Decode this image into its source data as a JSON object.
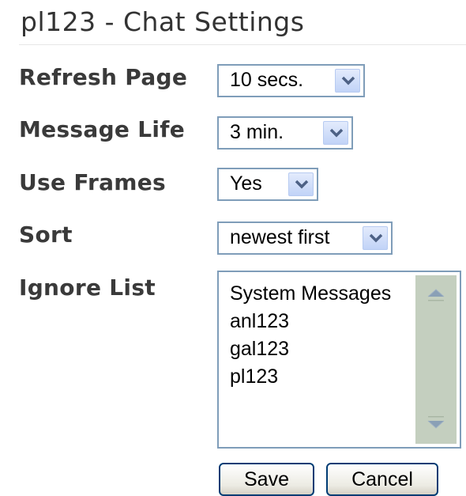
{
  "window": {
    "title": "pl123 - Chat Settings"
  },
  "settings": {
    "refresh_page": {
      "label": "Refresh Page",
      "value": "10 secs."
    },
    "message_life": {
      "label": "Message Life",
      "value": "3 min."
    },
    "use_frames": {
      "label": "Use Frames",
      "value": "Yes"
    },
    "sort": {
      "label": "Sort",
      "value": "newest first"
    },
    "ignore_list": {
      "label": "Ignore List",
      "items": [
        "System Messages",
        "anl123",
        "gal123",
        "pl123"
      ]
    }
  },
  "buttons": {
    "save": "Save",
    "cancel": "Cancel"
  },
  "colors": {
    "field_border": "#7f9db9",
    "dropdown_arrow": "#4d6185",
    "scrollbar_track": "#c4cfbf",
    "button_border": "#003c74"
  },
  "icons": {
    "dropdown": "chevron-down-icon",
    "scroll_up": "scroll-up-icon",
    "scroll_down": "scroll-down-icon"
  }
}
